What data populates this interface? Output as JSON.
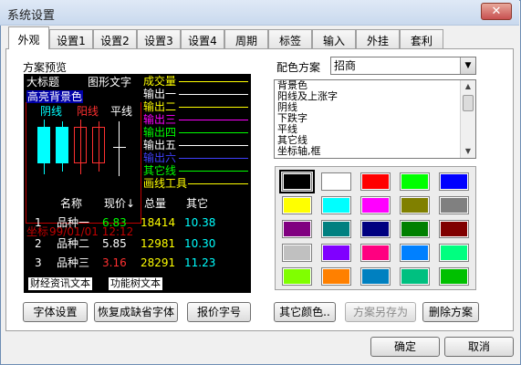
{
  "window": {
    "title": "系统设置",
    "close_glyph": "✕"
  },
  "tabs": [
    "外观",
    "设置1",
    "设置2",
    "设置3",
    "设置4",
    "周期",
    "标签",
    "输入",
    "外挂",
    "套利"
  ],
  "preview": {
    "label": "方案预览",
    "big_title": "大标题",
    "graphic_text": "图形文字",
    "high_bg": "高亮背景色",
    "yin": "阴线",
    "yang": "阳线",
    "ping": "平线",
    "coord": "坐标",
    "datetime": "99/01/01 12:12",
    "right_labels": [
      "成交量",
      "输出一",
      "输出二",
      "输出三",
      "输出四",
      "输出五",
      "输出六",
      "其它线",
      "画线工具"
    ],
    "table_headers": [
      "名称",
      "现价↓",
      "总量",
      "其它"
    ],
    "rows": [
      {
        "idx": "1",
        "name": "品种一",
        "price": "6.83",
        "vol": "18414",
        "other": "10.38"
      },
      {
        "idx": "2",
        "name": "品种二",
        "price": "5.85",
        "vol": "12981",
        "other": "10.30"
      },
      {
        "idx": "3",
        "name": "品种三",
        "price": "3.16",
        "vol": "28291",
        "other": "11.23"
      }
    ],
    "tag_news": "财经资讯文本",
    "tag_tree": "功能树文本"
  },
  "scheme": {
    "label": "配色方案",
    "selected": "招商",
    "items": [
      "背景色",
      "阳线及上涨字",
      "阴线",
      "下跌字",
      "平线",
      "其它线",
      "坐标轴,框"
    ]
  },
  "palette": [
    "#000000",
    "#ffffff",
    "#ff0000",
    "#00ff00",
    "#0000ff",
    "#ffff00",
    "#00ffff",
    "#ff00ff",
    "#808000",
    "#808080",
    "#800080",
    "#008080",
    "#000080",
    "#008000",
    "#800000",
    "#c0c0c0",
    "#8000ff",
    "#ff0080",
    "#0080ff",
    "#00ff80",
    "#80ff00",
    "#ff8000",
    "#0080c0",
    "#00c080",
    "#00c000"
  ],
  "buttons": {
    "font_settings": "字体设置",
    "restore_font": "恢复成缺省字体",
    "quote_font": "报价字号",
    "other_color": "其它颜色..",
    "save_scheme": "方案另存为",
    "delete_scheme": "删除方案",
    "ok": "确定",
    "cancel": "取消"
  }
}
